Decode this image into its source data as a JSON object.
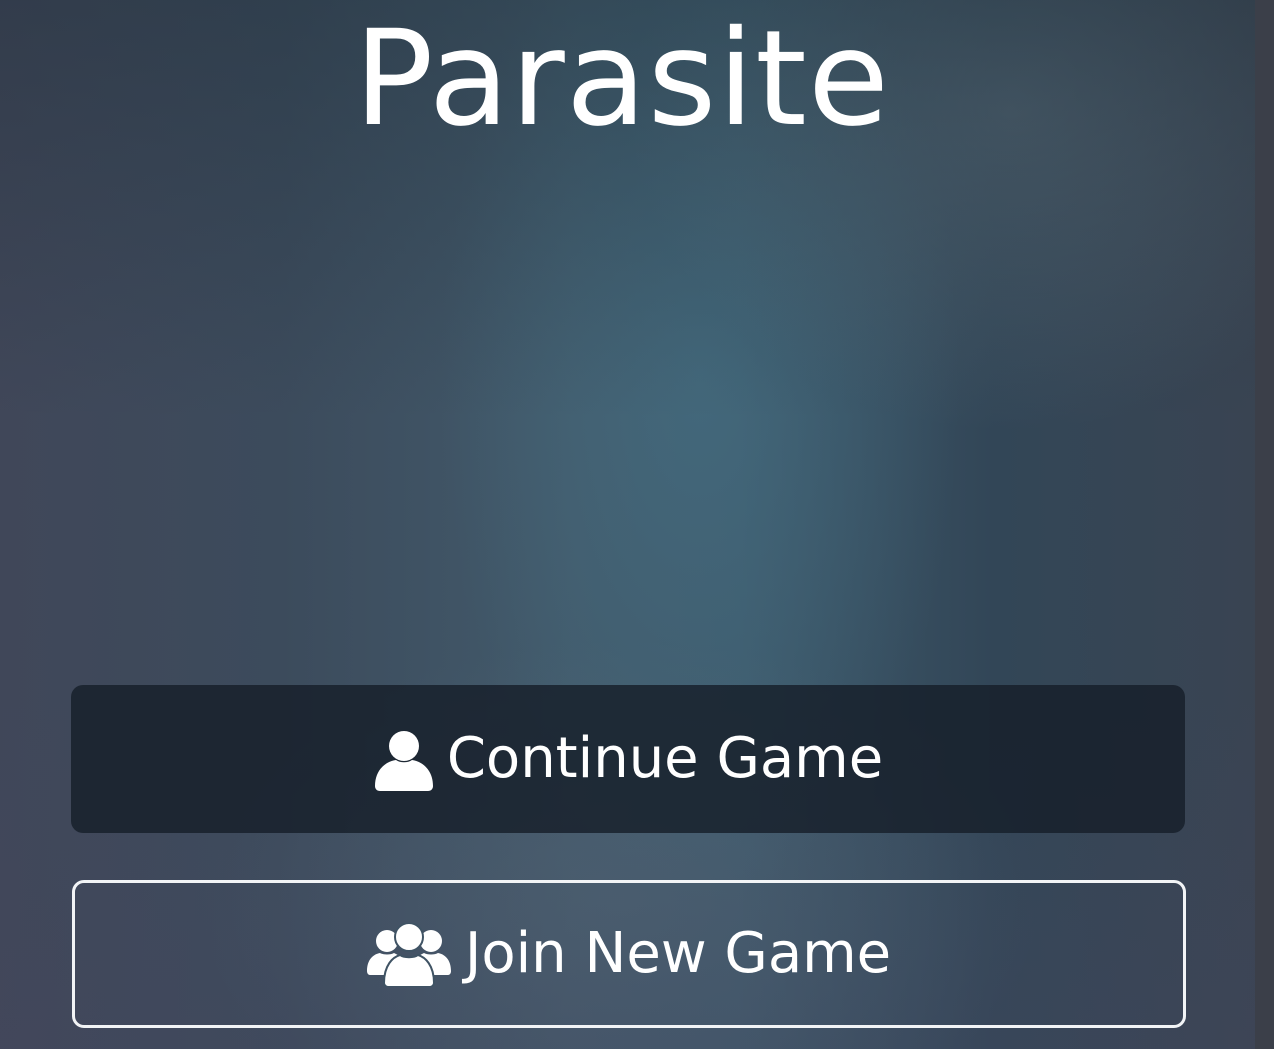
{
  "app": {
    "title": "Parasite"
  },
  "menu": {
    "continue": {
      "label": "Continue Game",
      "icon": "user-icon"
    },
    "join": {
      "label": "Join New Game",
      "icon": "users-icon"
    }
  },
  "colors": {
    "text": "#ffffff",
    "continue_button_bg": "#1a2330",
    "join_button_border": "#f2f4f6",
    "background": "#3e5a6c"
  }
}
